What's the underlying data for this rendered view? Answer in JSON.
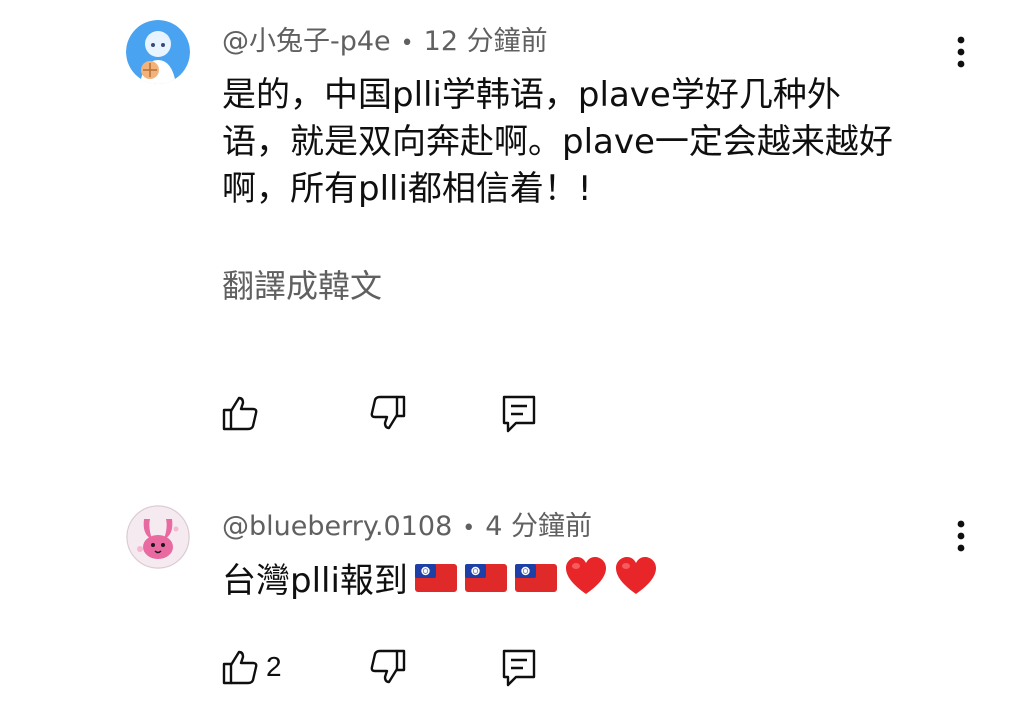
{
  "comments": [
    {
      "handle": "@小兔子-p4e",
      "time": "12 分鐘前",
      "text": "是的，中国plli学韩语，plave学好几种外\n语，就是双向奔赴啊。plave一定会越来越好\n啊，所有plli都相信着！!",
      "translate_label": "翻譯成韓文",
      "like_count": "",
      "avatar_colors": {
        "bg": "#4aa3f0",
        "accent": "#f2b27a"
      }
    },
    {
      "handle": "@blueberry.0108",
      "time": "4 分鐘前",
      "text": "台灣plli報到",
      "like_count": "2",
      "avatar_colors": {
        "bg": "#f4eaf0",
        "accent": "#e86aa0"
      }
    }
  ],
  "meta_separator": "•",
  "icons": {
    "like": "thumb-up-icon",
    "dislike": "thumb-down-icon",
    "reply": "reply-icon",
    "menu": "more-vert-icon"
  },
  "emoji": [
    "taiwan-flag",
    "taiwan-flag",
    "taiwan-flag",
    "red-heart",
    "red-heart"
  ]
}
